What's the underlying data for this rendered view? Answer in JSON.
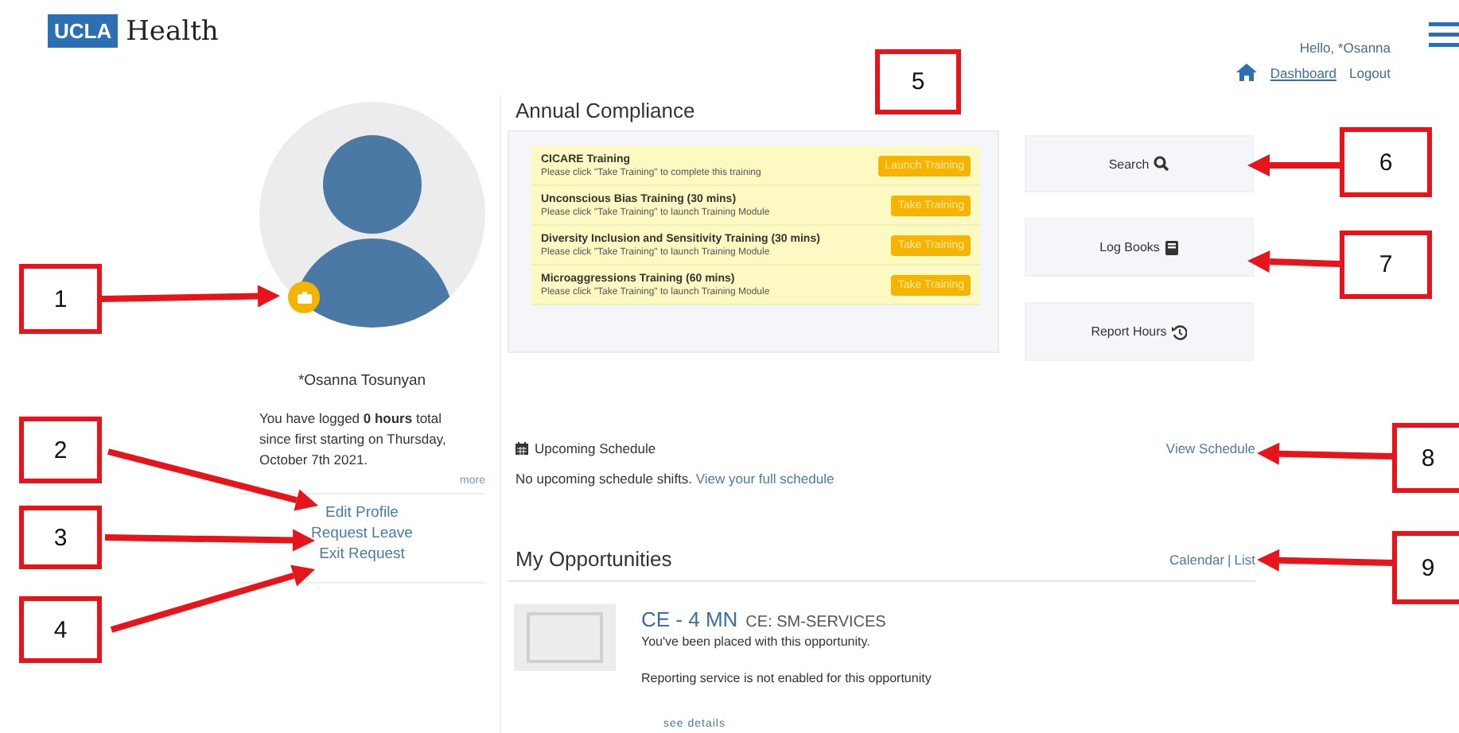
{
  "header": {
    "logo_mark": "UCLA",
    "logo_name": "Health",
    "greeting": "Hello, *Osanna",
    "links": [
      "Dashboard",
      "Logout"
    ]
  },
  "profile": {
    "name": "*Osanna Tosunyan",
    "summary": "You have logged **0 hours** total since first starting on Thursday, October 7th 2021.",
    "more": "more",
    "links": [
      "Edit Profile",
      "Request Leave",
      "Exit Request"
    ]
  },
  "compliance": {
    "title": "Annual Compliance",
    "trainings": [
      {
        "title": "CICARE Training",
        "description": "Please click \"Take Training\" to complete this training",
        "button": "Launch Training"
      },
      {
        "title": "Unconscious Bias Training (30 mins)",
        "description": "Please click \"Take Training\" to launch Training Module",
        "button": "Take Training"
      },
      {
        "title": "Diversity Inclusion and Sensitivity Training (30 mins)",
        "description": "Please click \"Take Training\" to launch Training Module",
        "button": "Take Training"
      },
      {
        "title": "Microaggressions Training (60 mins)",
        "description": "Please click \"Take Training\" to launch Training Module",
        "button": "Take Training"
      }
    ]
  },
  "actions": [
    {
      "label": "Search",
      "kind": "search"
    },
    {
      "label": "Log Books",
      "kind": "book"
    },
    {
      "label": "Report Hours",
      "kind": "history"
    }
  ],
  "schedule": {
    "title": "Upcoming Schedule",
    "link": "View Schedule",
    "message": "No upcoming schedule shifts.",
    "message_link": "View your full schedule"
  },
  "opportunities": {
    "title": "My Opportunities",
    "views": [
      "Calendar",
      "List"
    ],
    "separator": "|",
    "items": [
      {
        "title": "CE - 4 MN",
        "code": "CE: SM-SERVICES",
        "status": "You've been placed with this opportunity.",
        "note": "Reporting service is not enabled for this opportunity",
        "details": "see details"
      }
    ]
  },
  "callouts": [
    {
      "label": "1"
    },
    {
      "label": "2"
    },
    {
      "label": "3"
    },
    {
      "label": "4"
    },
    {
      "label": "5"
    },
    {
      "label": "6"
    },
    {
      "label": "7"
    },
    {
      "label": "8"
    },
    {
      "label": "9"
    }
  ]
}
